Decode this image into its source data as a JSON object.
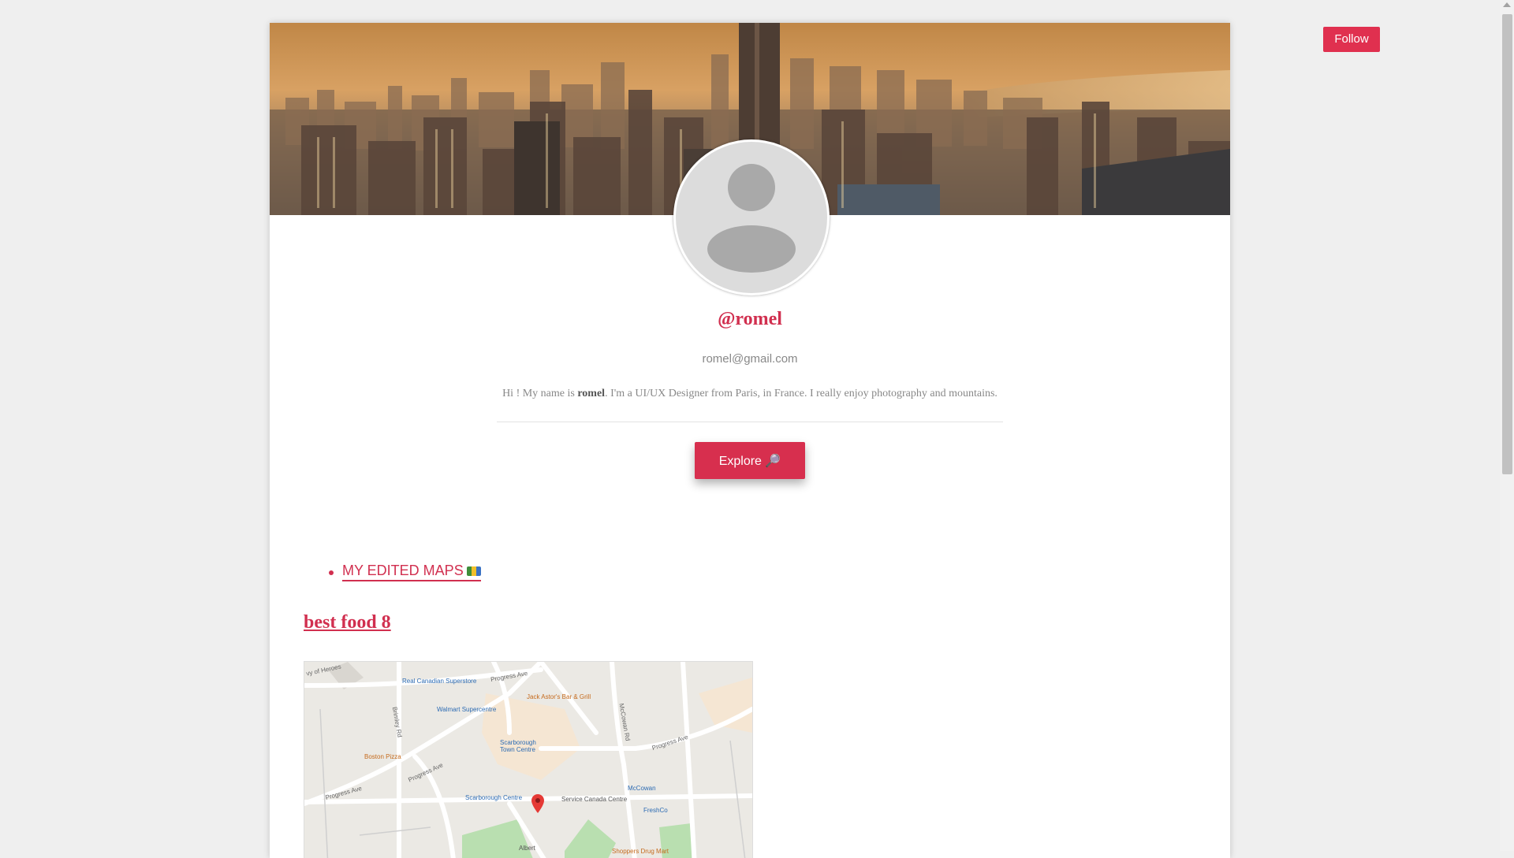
{
  "header": {
    "follow_label": "Follow"
  },
  "profile": {
    "username": "@romel",
    "email": "romel@gmail.com",
    "bio_prefix": "Hi ! My name is ",
    "bio_name": "romel",
    "bio_suffix": ". I'm a UI/UX Designer from Paris, in France. I really enjoy photography and mountains.",
    "explore_label": "Explore 🔎"
  },
  "maps": {
    "list_item_label": "MY EDITED MAPS",
    "map_title": "best food 8",
    "map_labels": {
      "heroes": "vy of Heroes",
      "real_canadian": "Real Canadian Superstore",
      "jack_astors": "Jack Astor's Bar & Grill",
      "walmart": "Walmart Supercentre",
      "scarborough_town_1": "Scarborough",
      "scarborough_town_2": "Town Centre",
      "boston_pizza": "Boston Pizza",
      "scarborough_centre": "Scarborough Centre",
      "service_canada": "Service Canada Centre",
      "mccowan": "McCowan",
      "freshco": "FreshCo",
      "shoppers": "Shoppers Drug Mart",
      "albert": "Albert",
      "progress_ave": "Progress Ave",
      "mccowan_rd": "McCowan Rd",
      "brimley_rd": "Brimley Rd"
    }
  },
  "colors": {
    "accent": "#d12f4f",
    "follow_bg": "#e0304f"
  }
}
